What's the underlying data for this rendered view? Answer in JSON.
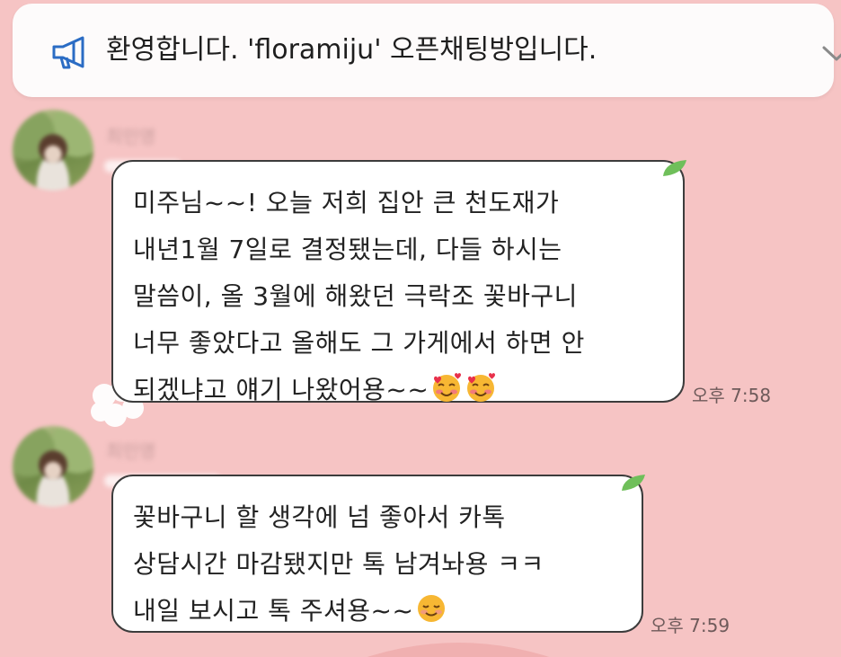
{
  "notice": {
    "icon": "megaphone-icon",
    "text": "환영합니다. 'floramiju' 오픈채팅방입니다.",
    "expand_icon": "chevron-down-icon"
  },
  "messages": [
    {
      "sender": "최민영",
      "lines": [
        "미주님~~! 오늘 저희 집안 큰 천도재가",
        "내년1월 7일로 결정됐는데, 다들 하시는",
        "말씀이, 올 3월에 해왔던 극락조 꽃바구니",
        "너무 좋았다고 올해도 그 가게에서 하면 안",
        "되겠냐고 얘기 나왔어용~~"
      ],
      "trailing_emoji": "smiling-face-with-hearts-emoji",
      "time": "오후 7:58"
    },
    {
      "sender": "최민영",
      "lines": [
        "꽃바구니 할 생각에 넘 좋아서 카톡",
        "상담시간 마감됐지만 톡 남겨놔용 ㅋㅋ",
        "내일 보시고 톡 주셔용~~"
      ],
      "trailing_emoji": "smiling-face-emoji",
      "time": "오후 7:59"
    }
  ],
  "colors": {
    "background": "#f6c4c4",
    "bubble": "#ffffff",
    "bubble_border": "#3c3c3c",
    "leaf": "#6fbf5a",
    "megaphone": "#2b6cc4"
  }
}
